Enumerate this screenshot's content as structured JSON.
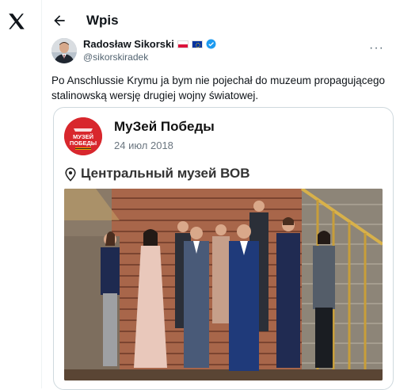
{
  "app": {
    "logo_icon": "x-logo-icon"
  },
  "header": {
    "title": "Wpis",
    "back_icon": "arrow-left-icon"
  },
  "post": {
    "author_name": "Radosław Sikorski",
    "handle": "@sikorskiradek",
    "badges": [
      "flag-poland",
      "flag-eu",
      "verified-badge"
    ],
    "text": "Po Anschlussie Krymu ja bym nie pojechał do muzeum propagującego stalinowską wersję drugiej wojny światowej."
  },
  "card": {
    "name": "MyЗей Победы",
    "date": "24 июл 2018",
    "location": "Центральный музей ВОВ",
    "logo_text_line1": "МУЗЕЙ",
    "logo_text_line2": "ПОБЕДЫ"
  },
  "colors": {
    "accent": "#1d9bf0",
    "flag_red": "#dc143c",
    "eu_blue": "#0033a0",
    "card_logo_red": "#d8272d"
  }
}
